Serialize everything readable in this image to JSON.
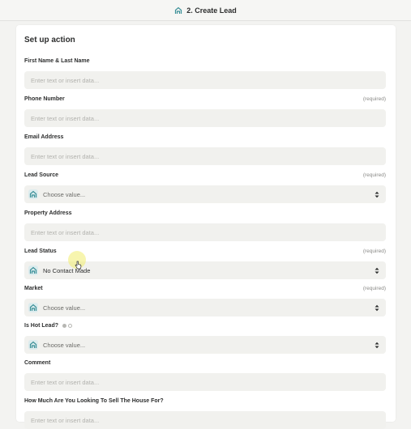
{
  "header": {
    "title": "2. Create Lead",
    "app_icon": "home-icon"
  },
  "section": {
    "title": "Set up action"
  },
  "fields": [
    {
      "label": "First Name & Last Name",
      "required": "",
      "type": "text",
      "placeholder": "Enter text or insert data..."
    },
    {
      "label": "Phone Number",
      "required": "(required)",
      "type": "text",
      "placeholder": "Enter text or insert data..."
    },
    {
      "label": "Email Address",
      "required": "",
      "type": "text",
      "placeholder": "Enter text or insert data..."
    },
    {
      "label": "Lead Source",
      "required": "(required)",
      "type": "select",
      "value": "Choose value..."
    },
    {
      "label": "Property Address",
      "required": "",
      "type": "text",
      "placeholder": "Enter text or insert data..."
    },
    {
      "label": "Lead Status",
      "required": "(required)",
      "type": "select",
      "value": "No Contact Made"
    },
    {
      "label": "Market",
      "required": "(required)",
      "type": "select",
      "value": "Choose value..."
    },
    {
      "label": "Is Hot Lead?",
      "required": "",
      "type": "select",
      "value": "Choose value..."
    },
    {
      "label": "Comment",
      "required": "",
      "type": "text",
      "placeholder": "Enter text or insert data..."
    },
    {
      "label": "How Much Are You Looking To Sell The House For?",
      "required": "",
      "type": "text",
      "placeholder": "Enter text or insert data..."
    }
  ],
  "colors": {
    "icon_teal": "#3a8f97",
    "icon_bg": "#dcecee",
    "accent_green": "#7bc47f"
  }
}
